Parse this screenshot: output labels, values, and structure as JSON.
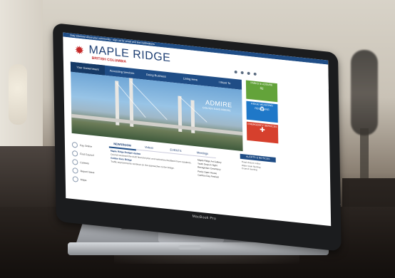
{
  "screen": {
    "alert_bar": "Stay informed about your community - sign up for email and text notifications",
    "site_title": "MAPLE RIDGE",
    "site_subtitle": "BRITISH COLUMBIA",
    "nav": [
      "Your Government",
      "Accessing Services",
      "Doing Business",
      "Living Here",
      "I Want To"
    ],
    "hero_title": "ADMIRE",
    "hero_subtitle": "GOLDEN EARS BRIDGE",
    "side_tiles": [
      {
        "label": "PARKS & LEISURE",
        "icon": "swimmer-icon"
      },
      {
        "label": "RIDGE MEADOWS RECYCLING",
        "icon": "recycle-icon"
      },
      {
        "label": "EMERGENCY SERVICES",
        "icon": "fire-icon"
      }
    ],
    "quick_links": [
      "Pay Online",
      "Find Council",
      "Careers",
      "Report Issue",
      "Maps"
    ],
    "tabs": [
      "NEWSROOM",
      "Videos",
      "EVENTS",
      "Meetings"
    ],
    "news": [
      {
        "title": "Maple Ridge Budget Update",
        "text": "Council reviewed the draft financial plan and welcomes feedback from residents."
      },
      {
        "title": "Golden Ears Bridge",
        "text": "Traffic improvements continue on the approaches to the bridge."
      }
    ],
    "events": [
      "Maple Ridge Art Gallery",
      "Youth Drop-in Night",
      "Recognition Ceremony",
      "Parks Open House",
      "Caribou Day Festival"
    ],
    "alerts_header": "ALERTS & NOTICES",
    "alerts": [
      "Road closure notice",
      "Water main flushing",
      "Council meeting"
    ]
  },
  "laptop_label": "MacBook Pro",
  "colors": {
    "brand_blue": "#1f4d86",
    "leaf_red": "#c62828",
    "tile_green": "#63a33a",
    "tile_blue": "#1f78c8",
    "tile_red": "#d6402d"
  }
}
